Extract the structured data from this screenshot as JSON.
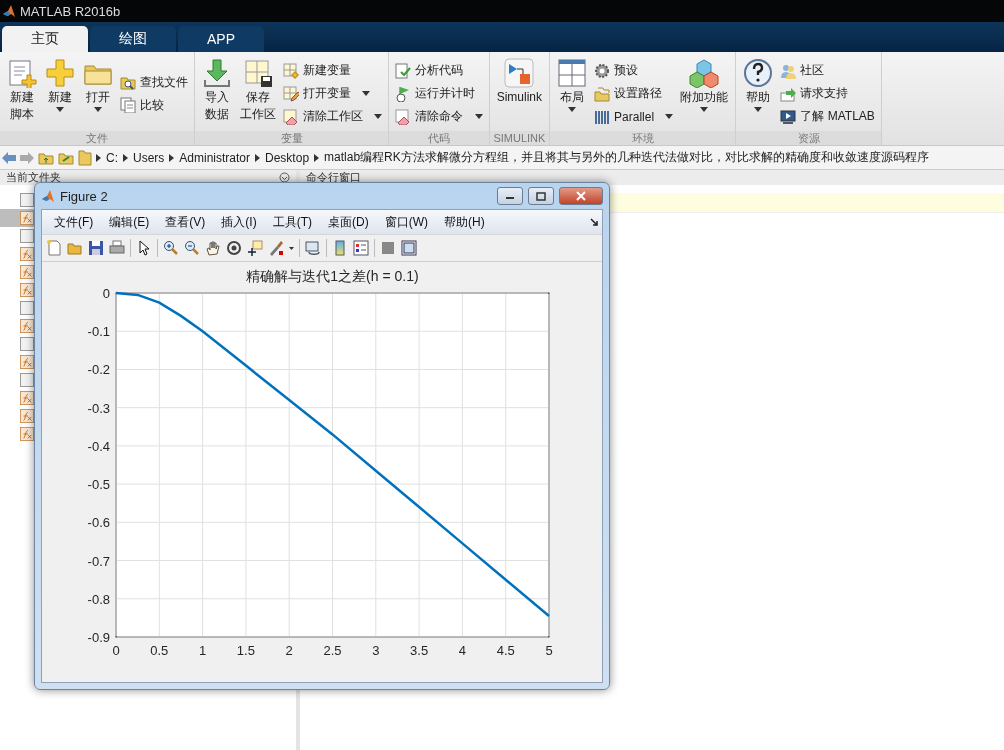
{
  "window": {
    "title": "MATLAB R2016b"
  },
  "tabs": [
    {
      "label": "主页",
      "selected": true
    },
    {
      "label": "绘图",
      "selected": false
    },
    {
      "label": "APP",
      "selected": false
    }
  ],
  "ribbon": {
    "groups": [
      {
        "label": "文件",
        "columns": [
          {
            "kind": "large",
            "lines": [
              "新建",
              "脚本"
            ],
            "dropdown": false
          },
          {
            "kind": "large",
            "label": "新建",
            "dropdown": true
          },
          {
            "kind": "large",
            "label": "打开",
            "dropdown": true
          },
          {
            "kind": "stack",
            "items": [
              {
                "label": "查找文件",
                "dropdown": false
              },
              {
                "label": "比较",
                "dropdown": false
              }
            ]
          }
        ]
      },
      {
        "label": "变量",
        "columns": [
          {
            "kind": "large",
            "lines": [
              "导入",
              "数据"
            ],
            "dropdown": false
          },
          {
            "kind": "large",
            "lines": [
              "保存",
              "工作区"
            ],
            "dropdown": false
          },
          {
            "kind": "stack",
            "items": [
              {
                "label": "新建变量",
                "dropdown": false
              },
              {
                "label": "打开变量",
                "dropdown": true
              },
              {
                "label": "清除工作区",
                "dropdown": true
              }
            ]
          }
        ]
      },
      {
        "label": "代码",
        "columns": [
          {
            "kind": "stack",
            "items": [
              {
                "label": "分析代码",
                "dropdown": false
              },
              {
                "label": "运行并计时",
                "dropdown": false
              },
              {
                "label": "清除命令",
                "dropdown": true
              }
            ]
          }
        ]
      },
      {
        "label": "SIMULINK",
        "columns": [
          {
            "kind": "large",
            "label": "Simulink",
            "dropdown": false
          }
        ]
      },
      {
        "label": "环境",
        "columns": [
          {
            "kind": "large",
            "label": "布局",
            "dropdown": true
          },
          {
            "kind": "stack",
            "items": [
              {
                "label": "预设",
                "dropdown": false
              },
              {
                "label": "设置路径",
                "dropdown": false
              },
              {
                "label": "Parallel",
                "dropdown": true
              }
            ]
          },
          {
            "kind": "large",
            "label": "附加功能",
            "dropdown": true
          }
        ]
      },
      {
        "label": "资源",
        "columns": [
          {
            "kind": "large",
            "label": "帮助",
            "dropdown": true
          },
          {
            "kind": "stack",
            "items": [
              {
                "label": "社区",
                "dropdown": false
              },
              {
                "label": "请求支持",
                "dropdown": false
              },
              {
                "label": "了解 MATLAB",
                "dropdown": false
              }
            ]
          }
        ]
      }
    ]
  },
  "address": {
    "path": [
      "C:",
      "Users",
      "Administrator",
      "Desktop",
      "matlab编程RK方法求解微分方程组，并且将其与另外的几种迭代法做对比，对比求解的精确度和收敛速度源码程序"
    ]
  },
  "current_folder": {
    "title": "当前文件夹",
    "files": [
      {
        "kind": "folder",
        "selected": false
      },
      {
        "kind": "function",
        "selected": true
      },
      {
        "kind": "folder",
        "selected": false
      },
      {
        "kind": "function",
        "selected": false
      },
      {
        "kind": "function",
        "selected": false
      },
      {
        "kind": "function",
        "selected": false
      },
      {
        "kind": "folder",
        "selected": false
      },
      {
        "kind": "function",
        "selected": false
      },
      {
        "kind": "folder",
        "selected": false
      },
      {
        "kind": "function",
        "selected": false
      },
      {
        "kind": "folder",
        "selected": false
      },
      {
        "kind": "function",
        "selected": false
      },
      {
        "kind": "function",
        "selected": false
      },
      {
        "kind": "function",
        "selected": false
      }
    ]
  },
  "command_window": {
    "title": "命令行窗口"
  },
  "figure": {
    "title": "Figure 2",
    "menu": [
      "文件(F)",
      "编辑(E)",
      "查看(V)",
      "插入(I)",
      "工具(T)",
      "桌面(D)",
      "窗口(W)",
      "帮助(H)"
    ],
    "chart_data": {
      "type": "line",
      "title": "精确解与迭代1之差(h = 0.1)",
      "x": [
        0,
        0.25,
        0.5,
        0.75,
        1,
        1.5,
        2,
        2.5,
        3,
        3.5,
        4,
        4.5,
        5
      ],
      "grid": true,
      "series": [
        {
          "color": "#0072bd",
          "values": [
            0,
            -0.005,
            -0.025,
            -0.06,
            -0.1,
            -0.19,
            -0.28,
            -0.37,
            -0.465,
            -0.56,
            -0.655,
            -0.75,
            -0.845
          ]
        }
      ],
      "xlim": [
        0,
        5
      ],
      "ylim": [
        -0.9,
        0
      ],
      "xticks": [
        0,
        0.5,
        1,
        1.5,
        2,
        2.5,
        3,
        3.5,
        4,
        4.5,
        5
      ],
      "yticks": [
        0,
        -0.1,
        -0.2,
        -0.3,
        -0.4,
        -0.5,
        -0.6,
        -0.7,
        -0.8,
        -0.9
      ]
    }
  }
}
